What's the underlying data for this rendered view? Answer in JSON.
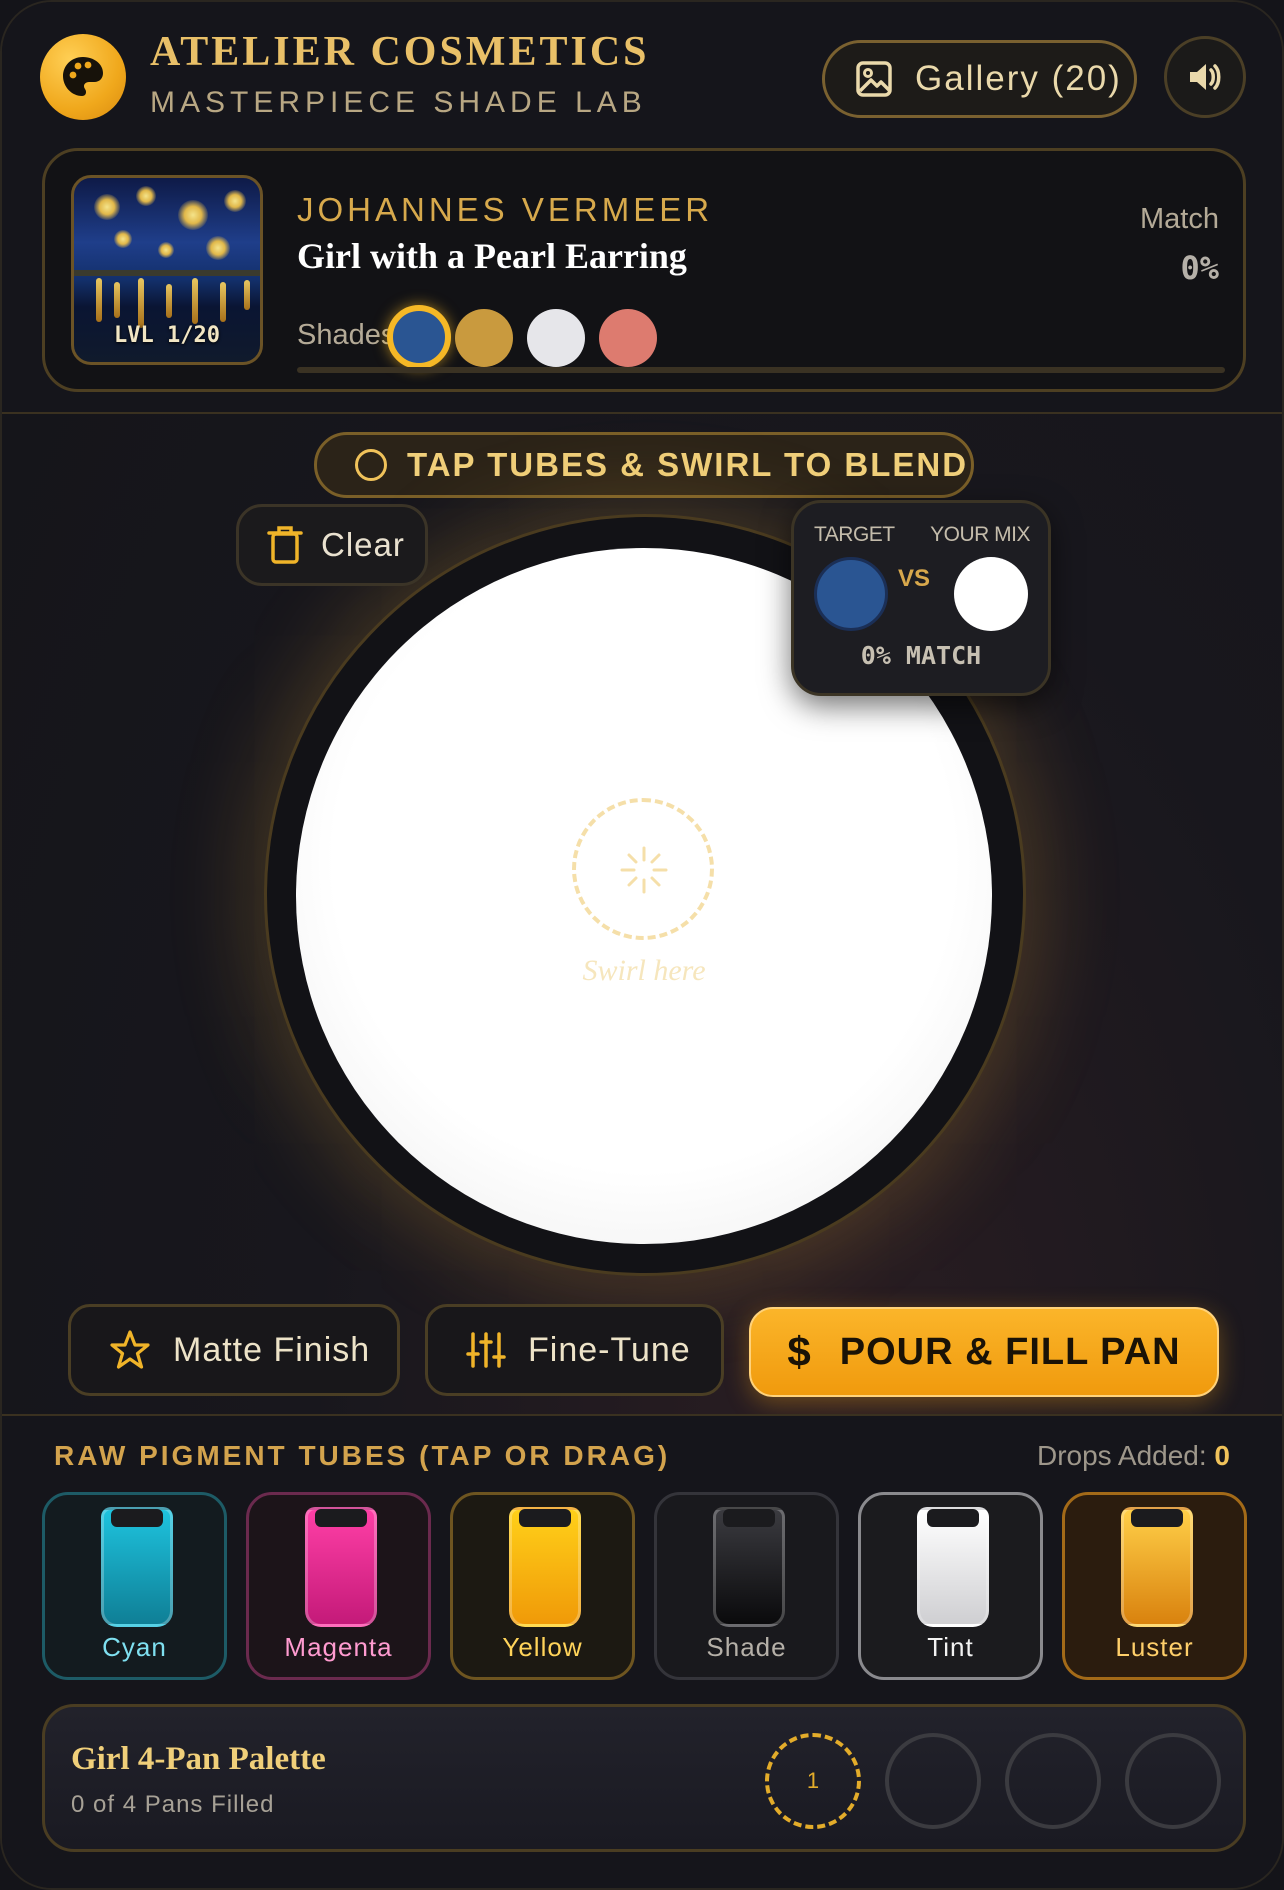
{
  "header": {
    "brand": "ATELIER COSMETICS",
    "subtitle": "MASTERPIECE SHADE LAB",
    "gallery_label": "Gallery (20)",
    "logo_icon": "palette-icon",
    "sound_icon": "speaker-icon"
  },
  "artwork": {
    "level": "LVL 1/20",
    "artist": "JOHANNES VERMEER",
    "title": "Girl with a Pearl Earring",
    "shades_label": "Shades:",
    "shades": [
      "#2a5592",
      "#c99a3e",
      "#e6e6ea",
      "#dd7b6f"
    ],
    "match_label": "Match",
    "match_value": "0%",
    "progress": 0
  },
  "hint": "TAP TUBES & SWIRL TO BLEND",
  "mixer": {
    "clear_label": "Clear",
    "swirl_text": "Swirl here",
    "target_label": "TARGET",
    "mix_label": "YOUR MIX",
    "vs": "VS",
    "target_color": "#2a5592",
    "mix_color": "#ffffff",
    "match_text": "0% MATCH"
  },
  "actions": {
    "matte_label": "Matte Finish",
    "finetune_label": "Fine-Tune",
    "pour_label": "POUR & FILL PAN"
  },
  "pigments": {
    "title": "RAW PIGMENT TUBES (TAP OR DRAG)",
    "drops_label": "Drops Added:",
    "drops_value": "0",
    "tubes": [
      {
        "name": "Cyan"
      },
      {
        "name": "Magenta"
      },
      {
        "name": "Yellow"
      },
      {
        "name": "Shade"
      },
      {
        "name": "Tint"
      },
      {
        "name": "Luster"
      }
    ]
  },
  "palette": {
    "title": "Girl 4-Pan Palette",
    "subtitle": "0 of 4 Pans Filled",
    "first_pan": "1"
  }
}
